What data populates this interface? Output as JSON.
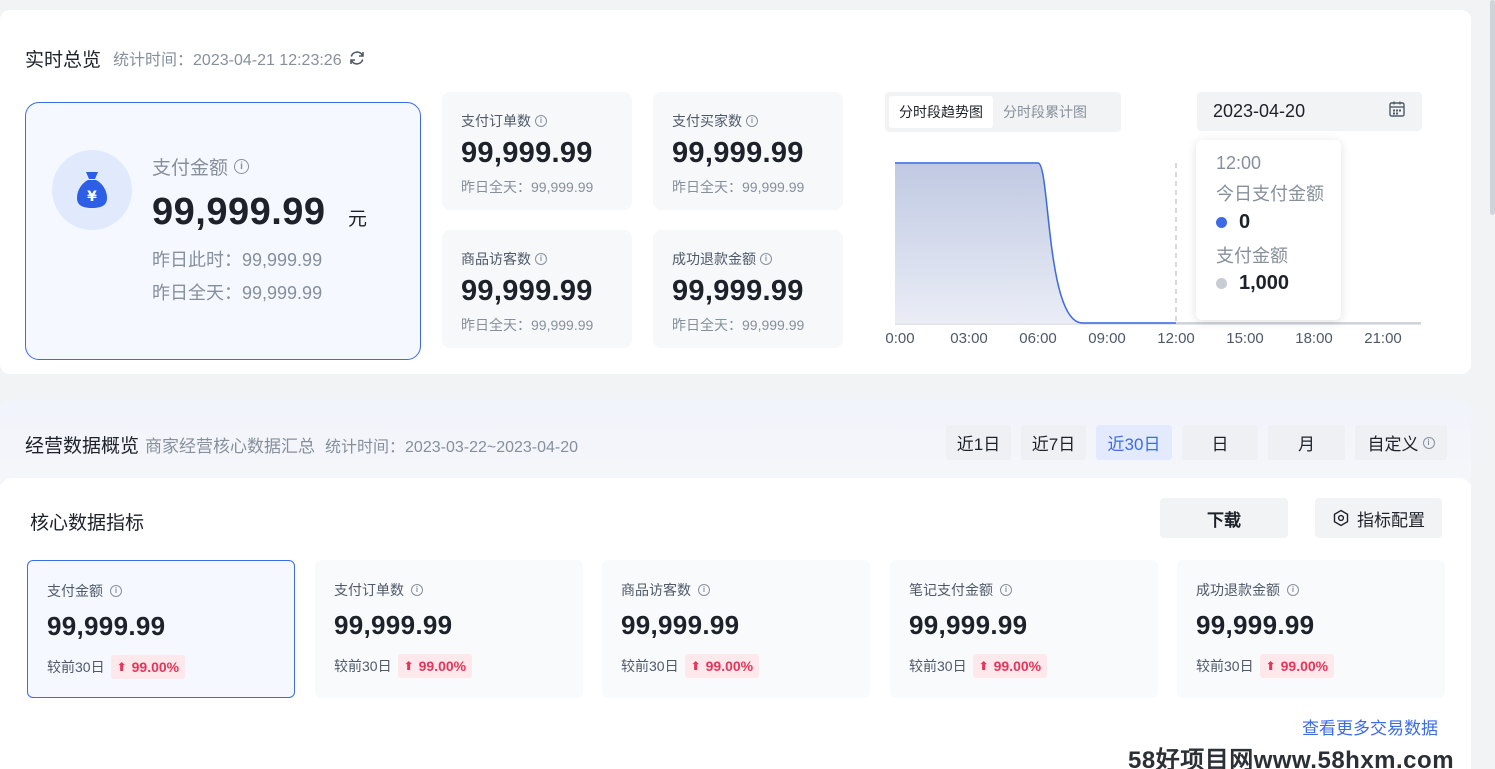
{
  "realtime": {
    "title": "实时总览",
    "stat_time": "统计时间：2023-04-21 12:23:26",
    "main": {
      "label": "支付金额",
      "value": "99,999.99",
      "unit": "元",
      "yesterday_now": "昨日此时：99,999.99",
      "yesterday_all": "昨日全天：99,999.99"
    },
    "metrics": [
      {
        "label": "支付订单数",
        "value": "99,999.99",
        "foot": "昨日全天：99,999.99"
      },
      {
        "label": "支付买家数",
        "value": "99,999.99",
        "foot": "昨日全天：99,999.99"
      },
      {
        "label": "商品访客数",
        "value": "99,999.99",
        "foot": "昨日全天：99,999.99"
      },
      {
        "label": "成功退款金额",
        "value": "99,999.99",
        "foot": "昨日全天：99,999.99"
      }
    ],
    "chart_tabs": [
      "分时段趋势图",
      "分时段累计图"
    ],
    "active_chart_tab": 0,
    "date": "2023-04-20",
    "tooltip": {
      "time": "12:00",
      "label1": "今日支付金额",
      "value1": "0",
      "label2": "支付金额",
      "value2": "1,000"
    }
  },
  "chart_data": {
    "type": "area",
    "x": [
      "0:00",
      "03:00",
      "06:00",
      "09:00",
      "12:00",
      "15:00",
      "18:00",
      "21:00"
    ],
    "series": [
      {
        "name": "今日支付金额",
        "color": "#3d6be8",
        "values": [
          1000,
          1000,
          1000,
          0,
          0,
          null,
          null,
          null
        ]
      },
      {
        "name": "支付金额",
        "color": "#c4c9d4",
        "values": [
          1000,
          1000,
          1000,
          0,
          0,
          0,
          0,
          0
        ]
      }
    ],
    "ylim": [
      0,
      1000
    ],
    "grid": false,
    "marker_x": "12:00"
  },
  "business": {
    "title": "经营数据概览",
    "subtitle": "商家经营核心数据汇总",
    "stat_time": "统计时间：2023-03-22~2023-04-20",
    "ranges": [
      "近1日",
      "近7日",
      "近30日",
      "日",
      "月",
      "自定义"
    ],
    "active_range": 2,
    "core_title": "核心数据指标",
    "download": "下载",
    "config": "指标配置",
    "kpis": [
      {
        "label": "支付金额",
        "value": "99,999.99",
        "compare": "较前30日",
        "change": "99.00%"
      },
      {
        "label": "支付订单数",
        "value": "99,999.99",
        "compare": "较前30日",
        "change": "99.00%"
      },
      {
        "label": "商品访客数",
        "value": "99,999.99",
        "compare": "较前30日",
        "change": "99.00%"
      },
      {
        "label": "笔记支付金额",
        "value": "99,999.99",
        "compare": "较前30日",
        "change": "99.00%"
      },
      {
        "label": "成功退款金额",
        "value": "99,999.99",
        "compare": "较前30日",
        "change": "99.00%"
      }
    ],
    "more": "查看更多交易数据"
  },
  "watermark": "58好项目网www.58hxm.com",
  "colors": {
    "accent": "#3d6be8",
    "up": "#e6355a"
  }
}
